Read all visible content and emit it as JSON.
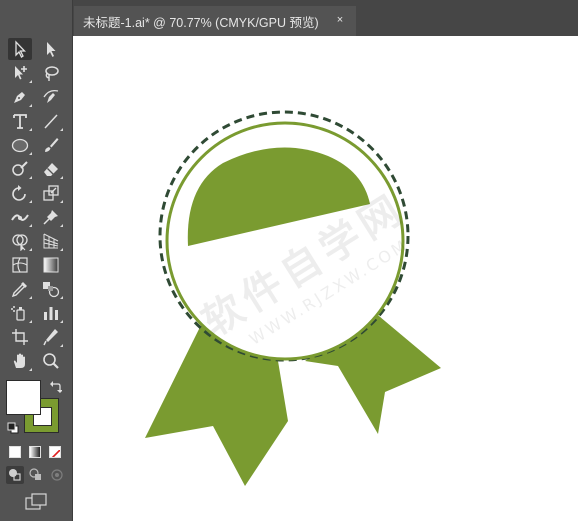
{
  "document_tab": {
    "title": "未标题-1.ai* @ 70.77% (CMYK/GPU 预览)",
    "close_glyph": "×"
  },
  "watermark": {
    "main_text": "软件自学网",
    "sub_text": "WWW.RJZXW.COM"
  },
  "colors": {
    "accent_green": "#7a9b30",
    "dashed_ring": "#2f4a34",
    "fill_swatch": "#ffffff",
    "stroke_swatch": "#7a9b30",
    "ui_background": "#535353",
    "canvas": "#ffffff"
  },
  "toolbar": {
    "tools": [
      {
        "name": "selection-tool",
        "icon": "arrow-outline-icon"
      },
      {
        "name": "direct-selection-tool",
        "icon": "arrow-filled-icon"
      },
      {
        "name": "group-selection-tool",
        "icon": "arrow-plus-icon"
      },
      {
        "name": "lasso-tool",
        "icon": "lasso-icon"
      },
      {
        "name": "pen-tool",
        "icon": "pen-icon"
      },
      {
        "name": "curvature-tool",
        "icon": "curvature-pen-icon"
      },
      {
        "name": "type-tool",
        "icon": "type-icon"
      },
      {
        "name": "line-tool",
        "icon": "line-icon"
      },
      {
        "name": "ellipse-tool",
        "icon": "ellipse-icon"
      },
      {
        "name": "paintbrush-tool",
        "icon": "brush-icon"
      },
      {
        "name": "blob-brush-tool",
        "icon": "blob-brush-icon"
      },
      {
        "name": "eraser-tool",
        "icon": "eraser-icon"
      },
      {
        "name": "rotate-tool",
        "icon": "rotate-icon"
      },
      {
        "name": "scale-tool",
        "icon": "scale-icon"
      },
      {
        "name": "width-tool",
        "icon": "width-icon"
      },
      {
        "name": "puppet-warp-tool",
        "icon": "pin-icon"
      },
      {
        "name": "shape-builder-tool",
        "icon": "shape-builder-icon"
      },
      {
        "name": "perspective-grid-tool",
        "icon": "perspective-grid-icon"
      },
      {
        "name": "mesh-tool",
        "icon": "mesh-icon"
      },
      {
        "name": "gradient-tool",
        "icon": "gradient-icon"
      },
      {
        "name": "eyedropper-tool",
        "icon": "eyedropper-icon"
      },
      {
        "name": "blend-tool",
        "icon": "blend-icon"
      },
      {
        "name": "symbol-sprayer-tool",
        "icon": "symbol-sprayer-icon"
      },
      {
        "name": "column-graph-tool",
        "icon": "bar-graph-icon"
      },
      {
        "name": "artboard-tool",
        "icon": "artboard-icon"
      },
      {
        "name": "slice-tool",
        "icon": "slice-icon"
      },
      {
        "name": "hand-tool",
        "icon": "hand-icon"
      },
      {
        "name": "zoom-tool",
        "icon": "zoom-icon"
      }
    ]
  }
}
